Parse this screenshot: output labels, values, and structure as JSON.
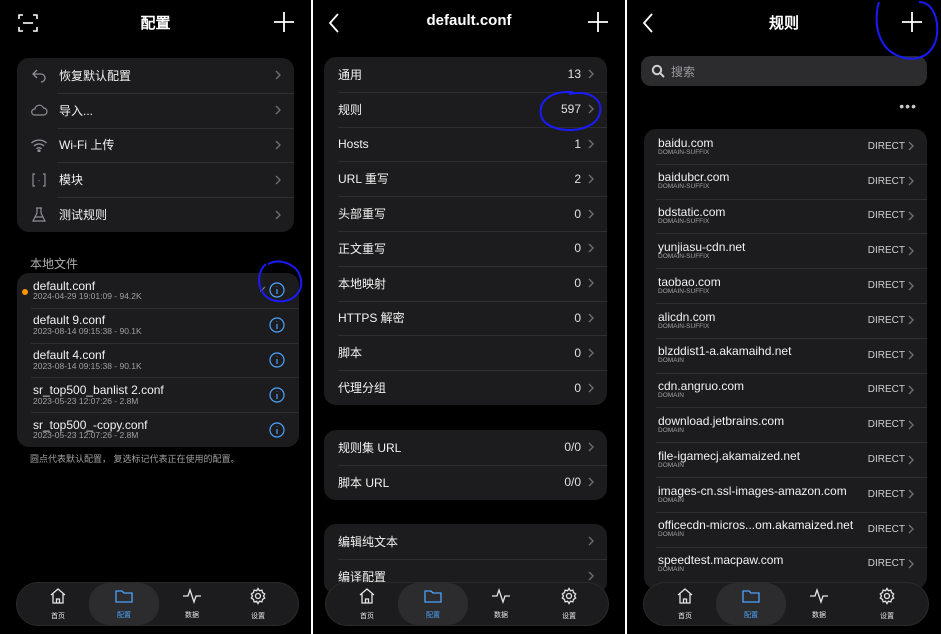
{
  "panel1": {
    "title": "配置",
    "menu": [
      {
        "label": "恢复默认配置",
        "icon": "reset-icon"
      },
      {
        "label": "导入...",
        "icon": "cloud-icon"
      },
      {
        "label": "Wi-Fi 上传",
        "icon": "wifi-icon"
      },
      {
        "label": "模块",
        "icon": "module-icon"
      },
      {
        "label": "测试规则",
        "icon": "test-icon"
      }
    ],
    "local_files_header": "本地文件",
    "files": [
      {
        "name": "default.conf",
        "meta": "2024-04-29 19:01:09 - 94.2K",
        "in_use": true,
        "default": true
      },
      {
        "name": "default 9.conf",
        "meta": "2023-08-14 09:15:38 - 90.1K",
        "in_use": false,
        "default": false
      },
      {
        "name": "default 4.conf",
        "meta": "2023-08-14 09:15:38 - 90.1K",
        "in_use": false,
        "default": false
      },
      {
        "name": "sr_top500_banlist 2.conf",
        "meta": "2023-05-23 12:07:26 - 2.8M",
        "in_use": false,
        "default": false
      },
      {
        "name": "sr_top500_-copy.conf",
        "meta": "2023-05-23 12:07:26 - 2.8M",
        "in_use": false,
        "default": false
      }
    ],
    "footnote": "圆点代表默认配置， 复选标记代表正在使用的配置。"
  },
  "panel2": {
    "title": "default.conf",
    "group1": [
      {
        "label": "通用",
        "value": "13"
      },
      {
        "label": "规则",
        "value": "597"
      },
      {
        "label": "Hosts",
        "value": "1"
      },
      {
        "label": "URL 重写",
        "value": "2"
      },
      {
        "label": "头部重写",
        "value": "0"
      },
      {
        "label": "正文重写",
        "value": "0"
      },
      {
        "label": "本地映射",
        "value": "0"
      },
      {
        "label": "HTTPS 解密",
        "value": "0"
      },
      {
        "label": "脚本",
        "value": "0"
      },
      {
        "label": "代理分组",
        "value": "0"
      }
    ],
    "group2": [
      {
        "label": "规则集 URL",
        "value": "0/0"
      },
      {
        "label": "脚本 URL",
        "value": "0/0"
      }
    ],
    "group3": [
      {
        "label": "编辑纯文本"
      },
      {
        "label": "编译配置"
      }
    ]
  },
  "panel3": {
    "title": "规则",
    "search_placeholder": "搜索",
    "more": "•••",
    "rules": [
      {
        "host": "baidu.com",
        "type": "DOMAIN-SUFFIX",
        "policy": "DIRECT"
      },
      {
        "host": "baidubcr.com",
        "type": "DOMAIN-SUFFIX",
        "policy": "DIRECT"
      },
      {
        "host": "bdstatic.com",
        "type": "DOMAIN-SUFFIX",
        "policy": "DIRECT"
      },
      {
        "host": "yunjiasu-cdn.net",
        "type": "DOMAIN-SUFFIX",
        "policy": "DIRECT"
      },
      {
        "host": "taobao.com",
        "type": "DOMAIN-SUFFIX",
        "policy": "DIRECT"
      },
      {
        "host": "alicdn.com",
        "type": "DOMAIN-SUFFIX",
        "policy": "DIRECT"
      },
      {
        "host": "blzddist1-a.akamaihd.net",
        "type": "DOMAIN",
        "policy": "DIRECT"
      },
      {
        "host": "cdn.angruo.com",
        "type": "DOMAIN",
        "policy": "DIRECT"
      },
      {
        "host": "download.jetbrains.com",
        "type": "DOMAIN",
        "policy": "DIRECT"
      },
      {
        "host": "file-igamecj.akamaized.net",
        "type": "DOMAIN",
        "policy": "DIRECT"
      },
      {
        "host": "images-cn.ssl-images-amazon.com",
        "type": "DOMAIN",
        "policy": "DIRECT"
      },
      {
        "host": "officecdn-micros...om.akamaized.net",
        "type": "DOMAIN",
        "policy": "DIRECT"
      },
      {
        "host": "speedtest.macpaw.com",
        "type": "DOMAIN",
        "policy": "DIRECT"
      }
    ]
  },
  "tabbar": [
    {
      "label": "首页",
      "icon": "home-icon"
    },
    {
      "label": "配置",
      "icon": "folder-icon",
      "active": true
    },
    {
      "label": "数据",
      "icon": "activity-icon"
    },
    {
      "label": "设置",
      "icon": "gear-icon"
    }
  ],
  "colors": {
    "background": "#000000",
    "card": "#1c1c1e",
    "accent": "#4da3ff",
    "default_dot": "#ff9500",
    "annotation": "#1a1aff"
  }
}
